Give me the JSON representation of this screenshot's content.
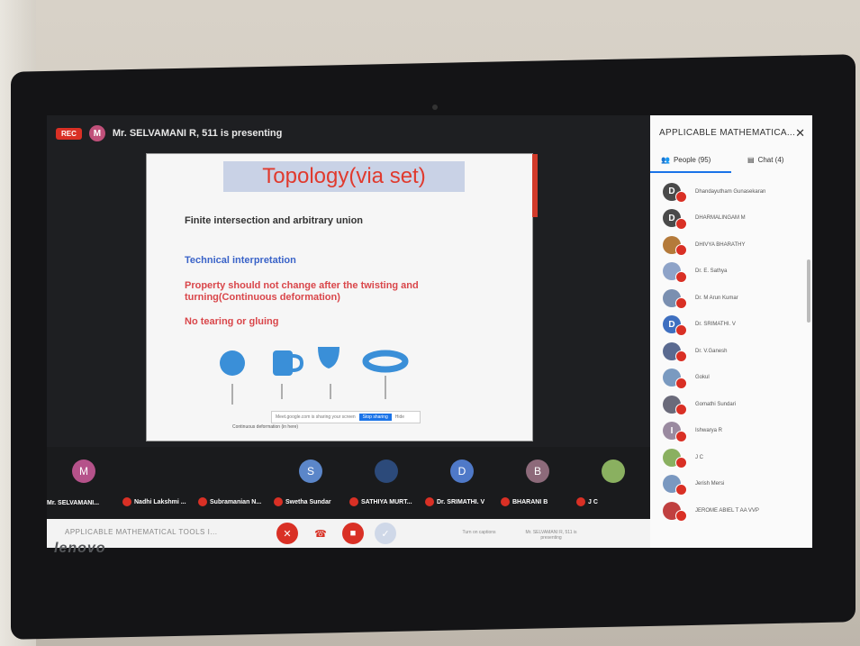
{
  "recording": {
    "badge": "REC"
  },
  "presenter": {
    "avatar_letter": "M",
    "text": "Mr. SELVAMANI R, 511 is presenting"
  },
  "slide": {
    "title": "Topology(via set)",
    "line1": "Finite intersection  and arbitrary union",
    "line2": "Technical interpretation",
    "line3": "Property  should not change after the twisting and turning(Continuous  deformation)",
    "line4": "No tearing or gluing",
    "share_text": "Meet.google.com is sharing your screen",
    "stop_label": "Stop sharing",
    "hide_label": "Hide",
    "caption": "Continuous deformation (in here)"
  },
  "tiles": [
    {
      "letter": "M",
      "name": "Mr. SELVAMANI...",
      "color": "#b5528a"
    },
    {
      "letter": "",
      "name": "Nadhi Lakshmi ...",
      "color": "#333"
    },
    {
      "letter": "",
      "name": "Subramanian N...",
      "color": "#333"
    },
    {
      "letter": "S",
      "name": "Swetha Sundar",
      "color": "#5b86c9"
    },
    {
      "letter": "",
      "name": "SATHIYA MURT...",
      "color": "#333"
    },
    {
      "letter": "D",
      "name": "Dr. SRIMATHI. V",
      "color": "#4f79c8"
    },
    {
      "letter": "B",
      "name": "BHARANI B",
      "color": "#8d6a7a"
    },
    {
      "letter": "",
      "name": "J C",
      "color": "#333"
    }
  ],
  "bottom_bar": {
    "meeting_title": "APPLICABLE MATHEMATICAL TOOLS I...",
    "captions_label": "Turn on captions",
    "presenting_label": "Mr. SELVAMANI R, 511 is presenting"
  },
  "panel": {
    "title": "APPLICABLE MATHEMATICA...",
    "people_tab": "People (95)",
    "chat_tab": "Chat (4)",
    "people": [
      {
        "initial": "D",
        "name": "Dhandayutham Gunasekaran",
        "color": "#4a4a4a"
      },
      {
        "initial": "D",
        "name": "DHARMALINGAM M",
        "color": "#4a4a4a"
      },
      {
        "initial": "",
        "name": "DHIVYA BHARATHY",
        "color": "#b47a3a"
      },
      {
        "initial": "",
        "name": "Dr. E. Sathya",
        "color": "#8ea3c8"
      },
      {
        "initial": "",
        "name": "Dr. M Arun Kumar",
        "color": "#7a8fb0"
      },
      {
        "initial": "D",
        "name": "Dr. SRIMATHI. V",
        "color": "#3e6fc0"
      },
      {
        "initial": "",
        "name": "Dr. V.Ganesh",
        "color": "#5a6a90"
      },
      {
        "initial": "",
        "name": "Gokul",
        "color": "#7a9ac0"
      },
      {
        "initial": "",
        "name": "Gomathi Sundari",
        "color": "#6a6a7a"
      },
      {
        "initial": "I",
        "name": "Ishwarya R",
        "color": "#9a8aa0"
      },
      {
        "initial": "",
        "name": "J C",
        "color": "#8ab060"
      },
      {
        "initial": "",
        "name": "Jerish Mersi",
        "color": "#7a98c0"
      },
      {
        "initial": "",
        "name": "JEROME ABIEL T AA VVP",
        "color": "#c04040"
      }
    ]
  },
  "brand": "lenovo"
}
